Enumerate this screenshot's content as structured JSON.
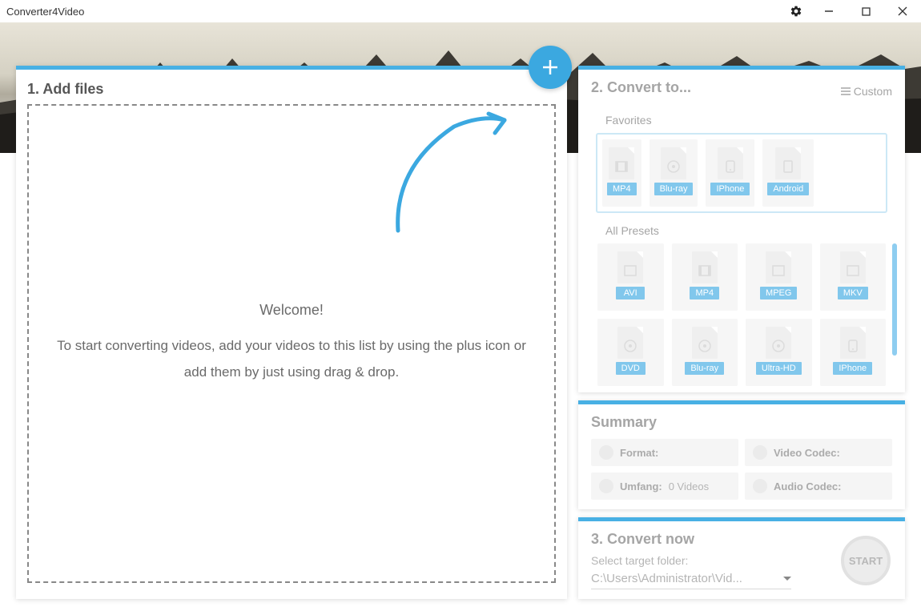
{
  "app_title": "Converter4Video",
  "left": {
    "title": "1. Add files",
    "welcome": "Welcome!",
    "desc": "To start converting videos, add your videos to this list by using the plus icon or add them by just using drag & drop."
  },
  "convert_to": {
    "title": "2. Convert to...",
    "custom": "Custom",
    "favorites_label": "Favorites",
    "favorites": [
      "MP4",
      "Blu-ray",
      "IPhone",
      "Android"
    ],
    "all_presets_label": "All Presets",
    "presets": [
      "AVI",
      "MP4",
      "MPEG",
      "MKV",
      "DVD",
      "Blu-ray",
      "Ultra-HD",
      "IPhone"
    ]
  },
  "summary": {
    "title": "Summary",
    "format": "Format:",
    "video_codec": "Video Codec:",
    "umfang": "Umfang:",
    "umfang_val": "0 Videos",
    "audio_codec": "Audio Codec:"
  },
  "convert_now": {
    "title": "3. Convert now",
    "target_label": "Select target folder:",
    "path": "C:\\Users\\Administrator\\Vid...",
    "start": "START"
  }
}
